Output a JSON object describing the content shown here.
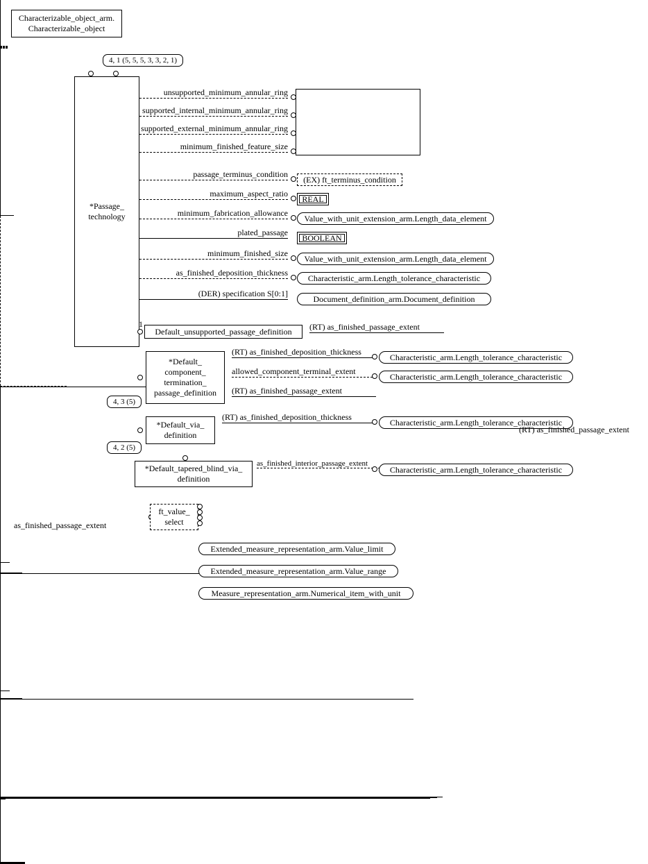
{
  "root_prefix": "Characterizable_object_arm.",
  "root_name": "Characterizable_object",
  "page_tag_top": "4, 1 (5, 5, 5, 3, 3, 2, 1)",
  "passage_tech": "*Passage_\ntechnology",
  "length_el_block": "Value_with_unit_\nextension_arm.Length_\ndata_element",
  "rel": {
    "unsupp_min_ann": "unsupported_minimum_annular_ring",
    "supp_int_min_ann": "supported_internal_minimum_annular_ring",
    "supp_ext_min_ann": "supported_external_minimum_annular_ring",
    "min_fin_feat": "minimum_finished_feature_size",
    "passage_term": "passage_terminus_condition",
    "max_aspect": "maximum_aspect_ratio",
    "min_fab_allow": "minimum_fabrication_allowance",
    "plated": "plated_passage",
    "min_fin_size": "minimum_finished_size",
    "as_fin_dep_th": "as_finished_deposition_thickness",
    "spec": "(DER) specification S[0:1]",
    "rt_fin_ext": "(RT) as_finished_passage_extent",
    "rt_fin_dep_th": "(RT) as_finished_deposition_thickness",
    "allowed_term_ext": "allowed_component_terminal_extent",
    "rt_fin_ext2": "(RT) as_finished_passage_extent",
    "rt_fin_dep_th2": "(RT) as_finished_deposition_thickness",
    "rt_fin_ext3": "(RT) as_finished_passage_extent",
    "int_pass_ext": "as_finished_interior_passage_extent",
    "as_fin_pass_ext_bottom": "as_finished_passage_extent"
  },
  "type_exft": "(EX) ft_terminus_condition",
  "type_real": "REAL",
  "type_len_el": "Value_with_unit_extension_arm.Length_data_element",
  "type_bool": "BOOLEAN",
  "type_len_tol": "Characteristic_arm.Length_tolerance_characteristic",
  "type_doc_def": "Document_definition_arm.Document_definition",
  "entity_def_unsupp": "Default_unsupported_passage_definition",
  "entity_def_comp_term": "*Default_\ncomponent_\ntermination_\npassage_definition",
  "page_tag_435": "4, 3 (5)",
  "entity_def_via": "*Default_via_\ndefinition",
  "page_tag_425": "4, 2 (5)",
  "entity_def_tapered": "*Default_tapered_blind_via_\ndefinition",
  "ft_value_select": "ft_value_\nselect",
  "ext_val_limit": "Extended_measure_representation_arm.Value_limit",
  "ext_val_range": "Extended_measure_representation_arm.Value_range",
  "num_with_unit": "Measure_representation_arm.Numerical_item_with_unit",
  "one": "1"
}
